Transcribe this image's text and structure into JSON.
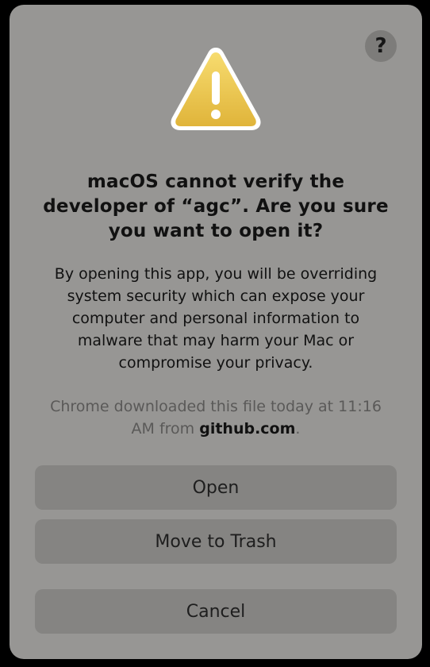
{
  "dialog": {
    "help_label": "?",
    "icon": "warning-triangle-icon",
    "title": "macOS cannot verify the developer of “agc”. Are you sure you want to open it?",
    "body": "By opening this app, you will be overriding system security which can expose your computer and personal information to malware that may harm your Mac or compromise your privacy.",
    "download_note_prefix": "Chrome downloaded this file today at 11:16 AM from ",
    "download_host": "github.com",
    "download_note_suffix": ".",
    "buttons": {
      "open": "Open",
      "trash": "Move to Trash",
      "cancel": "Cancel"
    }
  },
  "colors": {
    "dialog_bg": "#979694",
    "button_bg": "#858482",
    "warning_yellow": "#f2c94c"
  }
}
